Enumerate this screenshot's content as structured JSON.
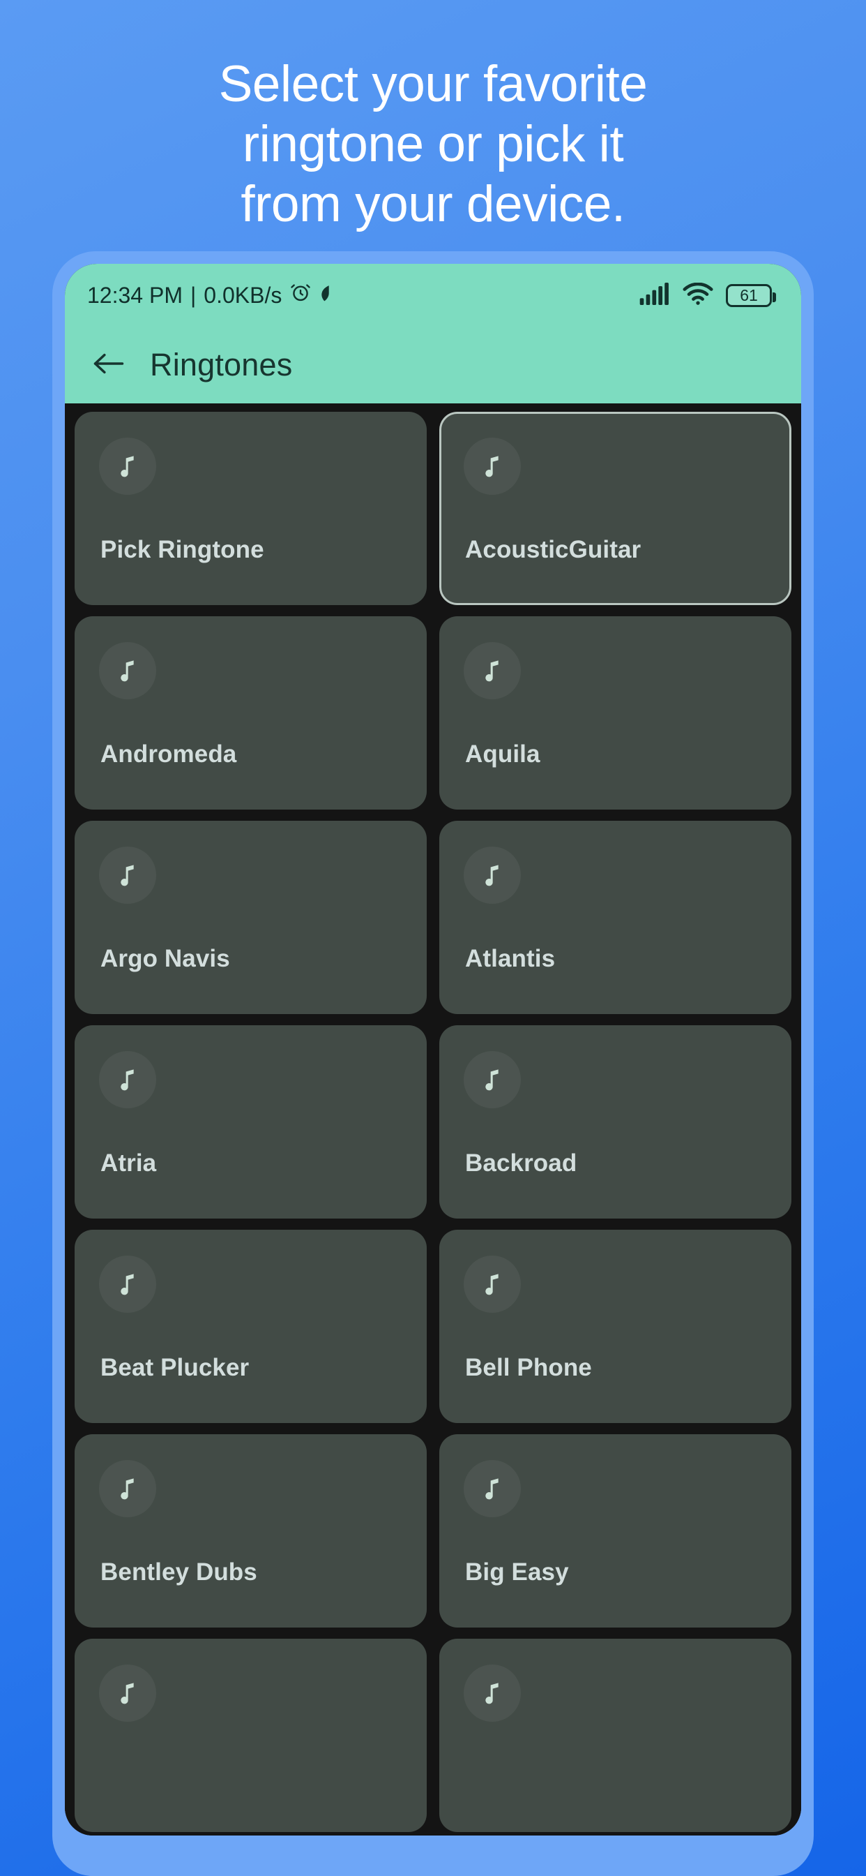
{
  "headline": "Select your favorite\nringtone or pick it\nfrom your device.",
  "colors": {
    "background_start": "#5a9bf3",
    "background_end": "#1565e8",
    "phone_bezel": "#6ea6f7",
    "screen_background": "#131313",
    "appbar": "#7ddcc0",
    "card": "#424b46",
    "card_label": "#d3dedd",
    "selected_border": "#b9c6c0"
  },
  "statusbar": {
    "time": "12:34 PM",
    "separator": "|",
    "network_speed": "0.0KB/s",
    "alarm_icon": "alarm-clock-icon",
    "leaf_icon": "leaf-icon",
    "signal_icon": "cellular-signal-icon",
    "wifi_icon": "wifi-icon",
    "battery_level": "61"
  },
  "appbar": {
    "back_icon": "back-arrow-icon",
    "title": "Ringtones"
  },
  "grid": {
    "note_icon": "music-note-icon",
    "items": [
      {
        "label": "Pick Ringtone",
        "selected": false
      },
      {
        "label": "AcousticGuitar",
        "selected": true
      },
      {
        "label": "Andromeda",
        "selected": false
      },
      {
        "label": "Aquila",
        "selected": false
      },
      {
        "label": "Argo Navis",
        "selected": false
      },
      {
        "label": "Atlantis",
        "selected": false
      },
      {
        "label": "Atria",
        "selected": false
      },
      {
        "label": "Backroad",
        "selected": false
      },
      {
        "label": "Beat Plucker",
        "selected": false
      },
      {
        "label": "Bell Phone",
        "selected": false
      },
      {
        "label": "Bentley Dubs",
        "selected": false
      },
      {
        "label": "Big Easy",
        "selected": false
      },
      {
        "label": "",
        "selected": false
      },
      {
        "label": "",
        "selected": false
      }
    ]
  }
}
